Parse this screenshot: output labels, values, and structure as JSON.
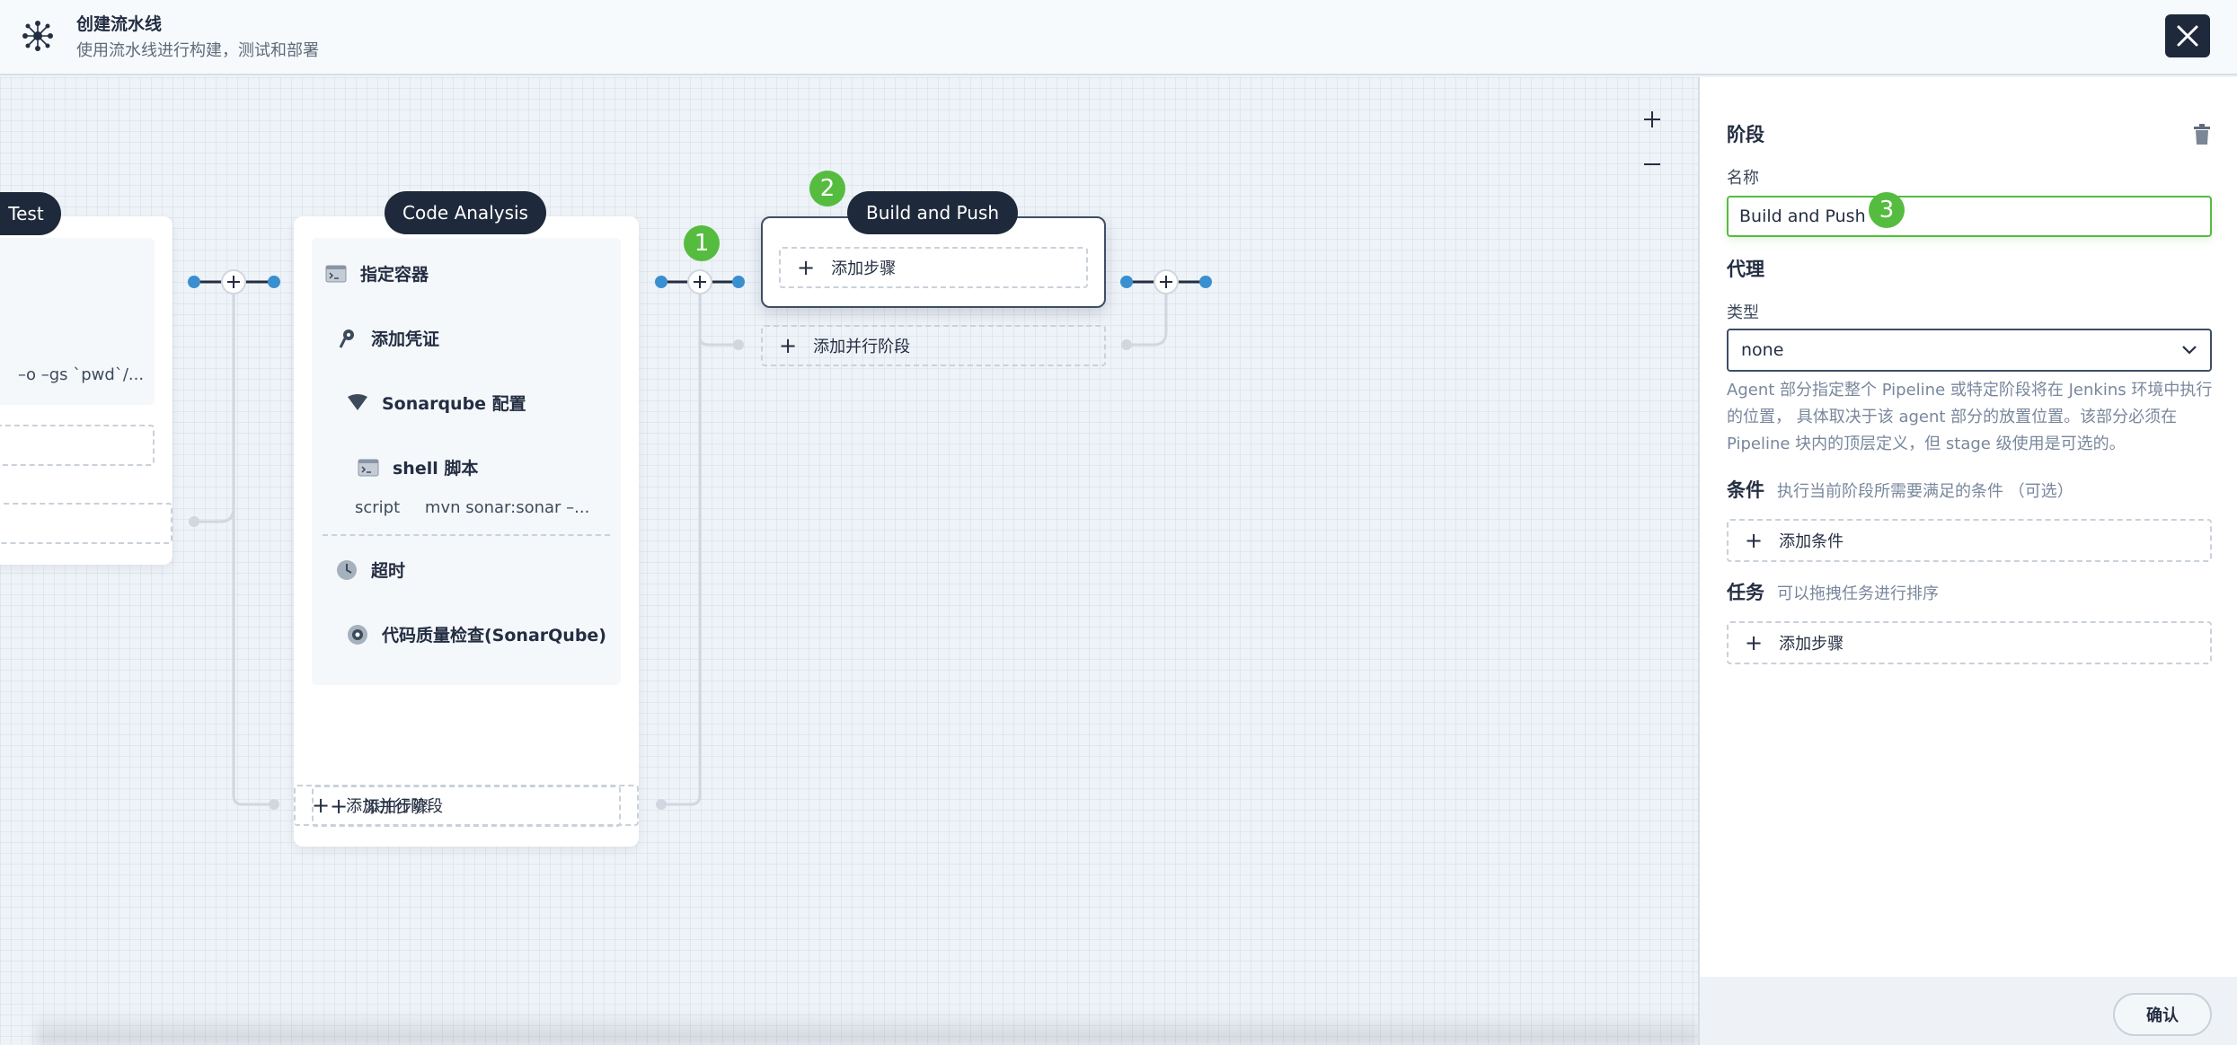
{
  "header": {
    "title": "创建流水线",
    "subtitle": "使用流水线进行构建，测试和部署"
  },
  "canvas": {
    "zoom_in": "+",
    "zoom_out": "−",
    "stages": {
      "test": {
        "name": "Test",
        "step_sub": "–o –gs `pwd`/..."
      },
      "code_analysis": {
        "name": "Code Analysis",
        "steps": [
          "指定容器",
          "添加凭证",
          "Sonarqube 配置",
          "shell 脚本",
          "超时",
          "代码质量检查(SonarQube)"
        ],
        "shell_script_key": "script",
        "shell_script_value": "mvn sonar:sonar –..."
      },
      "build_and_push": {
        "name": "Build and Push"
      }
    },
    "add_step_label": "添加步骤",
    "add_parallel_stage_label": "添加并行阶段",
    "badges": [
      "1",
      "2",
      "3"
    ]
  },
  "panel": {
    "stage_title": "阶段",
    "name_label": "名称",
    "name_value": "Build and Push",
    "agent_title": "代理",
    "type_label": "类型",
    "type_value": "none",
    "agent_desc": "Agent 部分指定整个 Pipeline 或特定阶段将在 Jenkins 环境中执行的位置， 具体取决于该 agent 部分的放置位置。该部分必须在 Pipeline 块内的顶层定义，但 stage 级使用是可选的。",
    "conditions_title": "条件",
    "conditions_hint": "执行当前阶段所需要满足的条件 （可选）",
    "add_condition_label": "添加条件",
    "tasks_title": "任务",
    "tasks_hint": "可以拖拽任务进行排序",
    "add_step_label": "添加步骤",
    "confirm_label": "确认"
  },
  "colors": {
    "dark": "#1e2a3b",
    "accent_green": "#55bc3f",
    "node_blue": "#3a8fd0"
  }
}
